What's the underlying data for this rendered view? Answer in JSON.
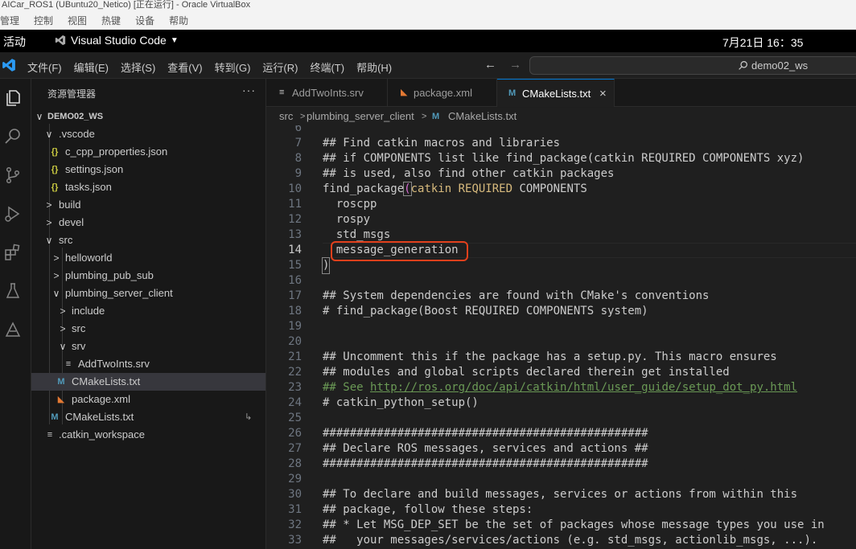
{
  "vbox": {
    "title": "AICar_ROS1 (UBuntu20_Netico) [正在运行] - Oracle VirtualBox",
    "menu": [
      "管理",
      "控制",
      "视图",
      "热键",
      "设备",
      "帮助"
    ]
  },
  "ubuntu": {
    "activities": "活动",
    "app_name": "Visual Studio Code",
    "clock": "7月21日  16：35"
  },
  "vscode": {
    "menu": [
      "文件(F)",
      "编辑(E)",
      "选择(S)",
      "查看(V)",
      "转到(G)",
      "运行(R)",
      "终端(T)",
      "帮助(H)"
    ],
    "nav_back": "←",
    "nav_forward": "→",
    "search_text": "demo02_ws"
  },
  "sidebar": {
    "title": "资源管理器",
    "more": "···",
    "root": "DEMO02_WS",
    "items": [
      {
        "label": ".vscode",
        "chevron": "∨"
      },
      {
        "label": "c_cpp_properties.json",
        "icon": "{}"
      },
      {
        "label": "settings.json",
        "icon": "{}"
      },
      {
        "label": "tasks.json",
        "icon": "{}"
      },
      {
        "label": "build",
        "chevron": ">"
      },
      {
        "label": "devel",
        "chevron": ">"
      },
      {
        "label": "src",
        "chevron": "∨"
      },
      {
        "label": "helloworld",
        "chevron": ">"
      },
      {
        "label": "plumbing_pub_sub",
        "chevron": ">"
      },
      {
        "label": "plumbing_server_client",
        "chevron": "∨"
      },
      {
        "label": "include",
        "chevron": ">"
      },
      {
        "label": "src",
        "chevron": ">"
      },
      {
        "label": "srv",
        "chevron": "∨"
      },
      {
        "label": "AddTwoInts.srv",
        "icon": "≡"
      },
      {
        "label": "CMakeLists.txt",
        "icon": "M"
      },
      {
        "label": "package.xml",
        "icon": "rss"
      },
      {
        "label": "CMakeLists.txt",
        "icon": "M",
        "badge": "↳"
      },
      {
        "label": ".catkin_workspace",
        "icon": "≡"
      }
    ]
  },
  "tabs": [
    {
      "label": "AddTwoInts.srv",
      "icon": "≡"
    },
    {
      "label": "package.xml",
      "icon": "rss"
    },
    {
      "label": "CMakeLists.txt",
      "icon": "M",
      "close": "×"
    }
  ],
  "breadcrumb": [
    "src",
    ">",
    "plumbing_server_client",
    ">",
    "CMakeLists.txt"
  ],
  "editor": {
    "lines": [
      {
        "n": "6",
        "t": ""
      },
      {
        "n": "7",
        "t": "## Find catkin macros and libraries"
      },
      {
        "n": "8",
        "t": "## if COMPONENTS list like find_package(catkin REQUIRED COMPONENTS xyz)"
      },
      {
        "n": "9",
        "t": "## is used, also find other catkin packages"
      },
      {
        "n": "10",
        "p1": "find_package",
        "p2": "(",
        "p3": "catkin REQUIRED",
        "p4": " COMPONENTS"
      },
      {
        "n": "11",
        "t": "  roscpp"
      },
      {
        "n": "12",
        "t": "  rospy"
      },
      {
        "n": "13",
        "t": "  std_msgs"
      },
      {
        "n": "14",
        "t": "  message_generation"
      },
      {
        "n": "15",
        "t": ")"
      },
      {
        "n": "16",
        "t": ""
      },
      {
        "n": "17",
        "t": "## System dependencies are found with CMake's conventions"
      },
      {
        "n": "18",
        "t": "# find_package(Boost REQUIRED COMPONENTS system)"
      },
      {
        "n": "19",
        "t": ""
      },
      {
        "n": "20",
        "t": ""
      },
      {
        "n": "21",
        "t": "## Uncomment this if the package has a setup.py. This macro ensures"
      },
      {
        "n": "22",
        "t": "## modules and global scripts declared therein get installed"
      },
      {
        "n": "23",
        "p1": "## See ",
        "p2": "http://ros.org/doc/api/catkin/html/user_guide/setup_dot_py.html"
      },
      {
        "n": "24",
        "t": "# catkin_python_setup()"
      },
      {
        "n": "25",
        "t": ""
      },
      {
        "n": "26",
        "t": "################################################"
      },
      {
        "n": "27",
        "t": "## Declare ROS messages, services and actions ##"
      },
      {
        "n": "28",
        "t": "################################################"
      },
      {
        "n": "29",
        "t": ""
      },
      {
        "n": "30",
        "t": "## To declare and build messages, services or actions from within this"
      },
      {
        "n": "31",
        "t": "## package, follow these steps:"
      },
      {
        "n": "32",
        "t": "## * Let MSG_DEP_SET be the set of packages whose message types you use in"
      },
      {
        "n": "33",
        "t": "##   your messages/services/actions (e.g. std_msgs, actionlib_msgs, ...)."
      }
    ]
  },
  "colors": {
    "accent": "#0078d4",
    "highlight_box": "#e2401c",
    "comment": "#6a9955"
  }
}
